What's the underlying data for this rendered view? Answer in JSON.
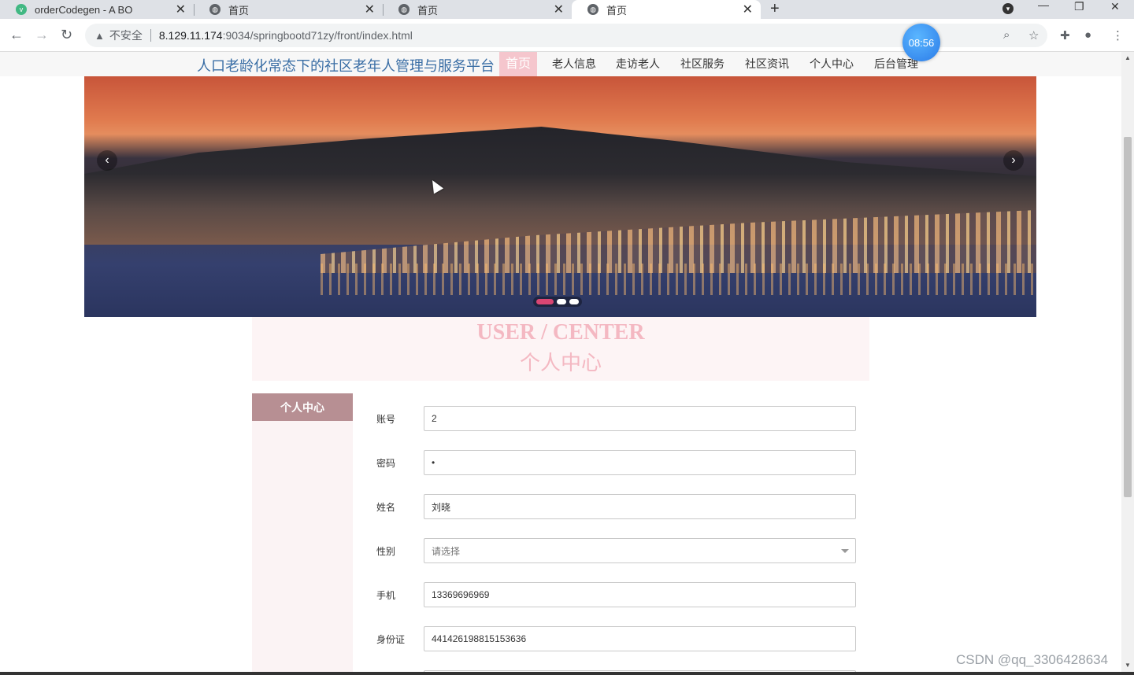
{
  "browser": {
    "tabs": [
      {
        "title": "orderCodegen - A BO",
        "favicon": "vue-icon"
      },
      {
        "title": "首页",
        "favicon": "globe-icon"
      },
      {
        "title": "首页",
        "favicon": "globe-icon"
      },
      {
        "title": "首页",
        "favicon": "globe-icon",
        "active": true
      }
    ],
    "security_label": "不安全",
    "url_host": "8.129.11.174",
    "url_path": ":9034/springbootd71zy/front/index.html",
    "timer": "08:56"
  },
  "site": {
    "title": "人口老龄化常态下的社区老年人管理与服务平台",
    "menu": [
      "首页",
      "老人信息",
      "走访老人",
      "社区服务",
      "社区资讯",
      "个人中心",
      "后台管理"
    ],
    "active_menu": "首页"
  },
  "carousel": {
    "slide_count": 3,
    "active_slide": 1,
    "prev_label": "‹",
    "next_label": "›"
  },
  "user_center": {
    "title_en": "USER / CENTER",
    "title_cn": "个人中心",
    "side_button": "个人中心",
    "fields": [
      {
        "label": "账号",
        "value": "2"
      },
      {
        "label": "密码",
        "value": "•"
      },
      {
        "label": "姓名",
        "value": "刘晓"
      },
      {
        "label": "性别",
        "value": "",
        "placeholder": "请选择",
        "type": "select"
      },
      {
        "label": "手机",
        "value": "13369696969"
      },
      {
        "label": "身份证",
        "value": "441426198815153636"
      }
    ]
  },
  "watermark": "CSDN @qq_3306428634",
  "colors": {
    "accent_pink": "#f5c6cd",
    "side_button": "#b78f93",
    "title_blue": "#3a6ea5",
    "dot_active": "#d94673"
  }
}
